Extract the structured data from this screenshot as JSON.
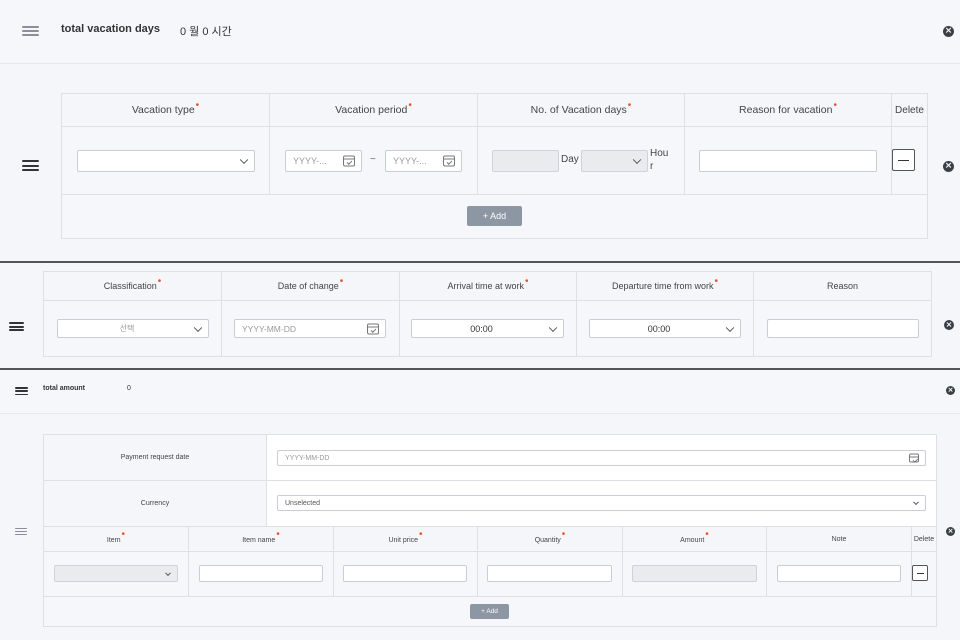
{
  "vacation": {
    "total_label": "total vacation days",
    "total_value": "0 월 0 시간",
    "headers": {
      "type": "Vacation type",
      "period": "Vacation period",
      "days": "No. of Vacation days",
      "reason": "Reason for vacation",
      "delete": "Delete"
    },
    "date_start_placeholder": "YYYY-...",
    "date_end_placeholder": "YYYY-...",
    "tilde": "~",
    "day_label": "Day",
    "hour_label": "Hou r",
    "add_label": "+ Add"
  },
  "attendance": {
    "headers": {
      "classification": "Classification",
      "date_of_change": "Date of change",
      "arrival": "Arrival time at work",
      "departure": "Departure time from work",
      "reason": "Reason"
    },
    "classification_value": "선택",
    "date_placeholder": "YYYY-MM-DD",
    "arrival_value": "00:00",
    "departure_value": "00:00"
  },
  "expense": {
    "total_label": "total amount",
    "total_value": "0",
    "payment_date_label": "Payment request date",
    "payment_date_placeholder": "YYYY-MM-DD",
    "currency_label": "Currency",
    "currency_value": "Unselected",
    "headers": {
      "item": "Item",
      "item_name": "Item name",
      "unit_price": "Unit price",
      "quantity": "Quantity",
      "amount": "Amount",
      "note": "Note",
      "delete": "Delete"
    },
    "add_label": "+ Add"
  }
}
